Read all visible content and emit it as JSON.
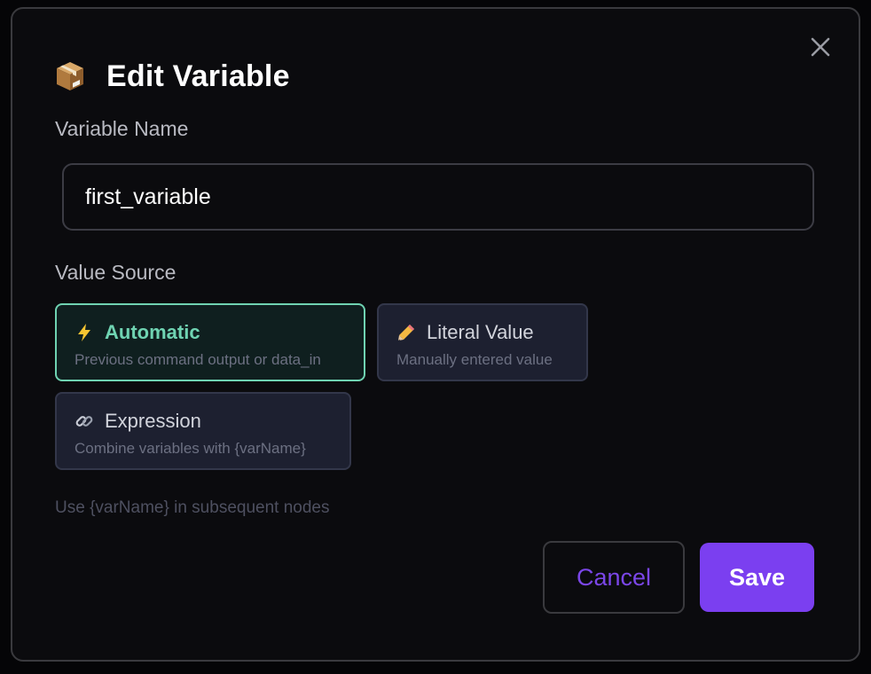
{
  "dialog": {
    "title": "Edit Variable",
    "title_icon": "package-icon",
    "close_icon": "close-icon"
  },
  "name_field": {
    "label": "Variable Name",
    "value": "first_variable"
  },
  "source": {
    "label": "Value Source",
    "selected": "automatic",
    "options": [
      {
        "id": "automatic",
        "icon": "lightning-icon",
        "title": "Automatic",
        "description": "Previous command output or data_in"
      },
      {
        "id": "literal",
        "icon": "pencil-icon",
        "title": "Literal Value",
        "description": "Manually entered value"
      },
      {
        "id": "expression",
        "icon": "link-icon",
        "title": "Expression",
        "description": "Combine variables with {varName}"
      }
    ]
  },
  "hint": "Use {varName} in subsequent nodes",
  "actions": {
    "cancel_label": "Cancel",
    "save_label": "Save"
  },
  "colors": {
    "accent": "#7b3ff0",
    "selected_border": "#6fd3b2",
    "modal_bg": "#0b0b0e"
  }
}
